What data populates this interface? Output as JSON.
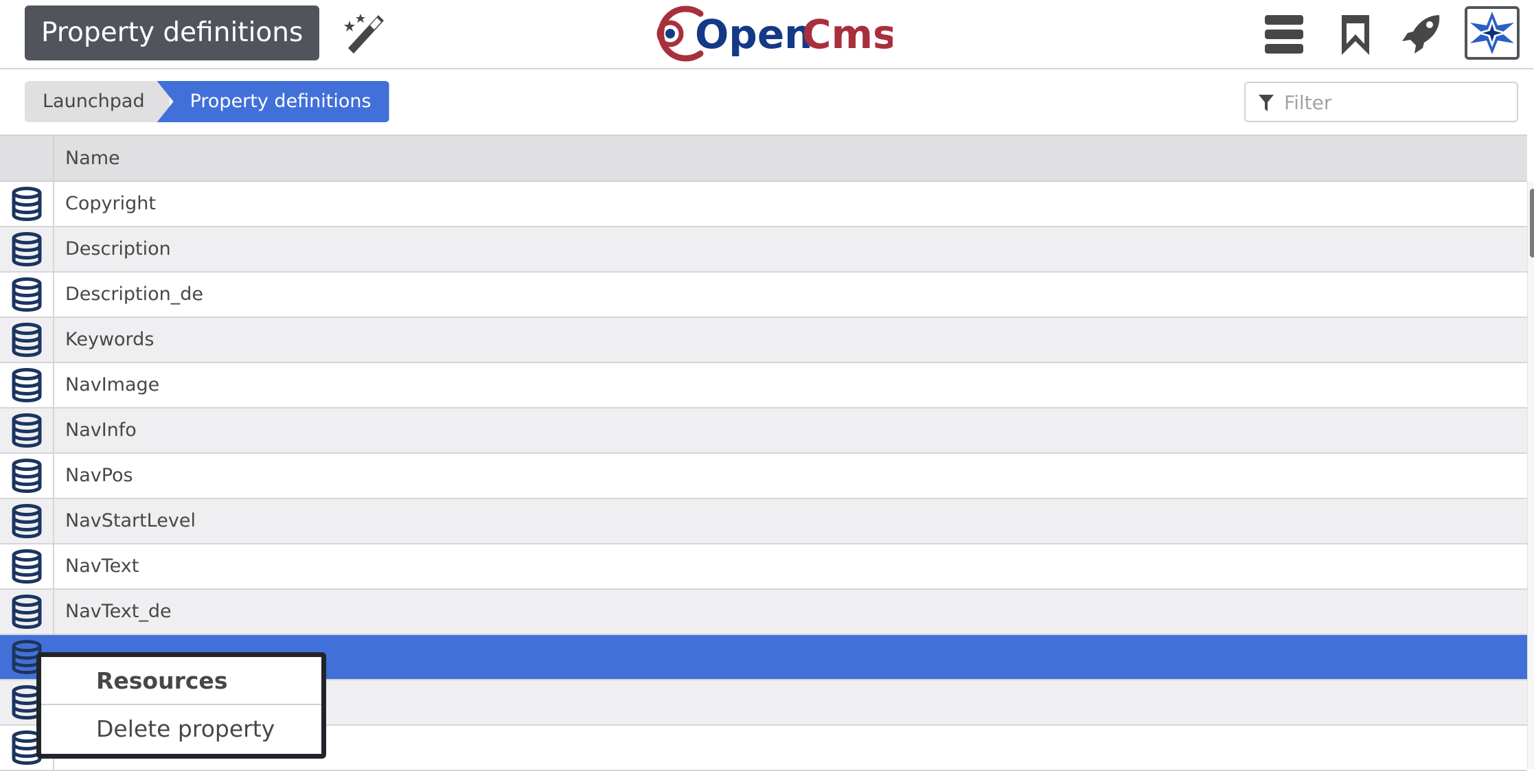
{
  "header": {
    "app_title": "Property definitions",
    "logo_text": "OpenCms",
    "icons": [
      "magic-wand-icon",
      "menu-icon",
      "bookmark-icon",
      "rocket-icon",
      "user-avatar"
    ]
  },
  "breadcrumb": {
    "items": [
      {
        "label": "Launchpad"
      },
      {
        "label": "Property definitions"
      }
    ]
  },
  "filter": {
    "placeholder": "Filter",
    "value": ""
  },
  "table": {
    "columns": [
      "Name"
    ],
    "rows": [
      {
        "name": "Copyright"
      },
      {
        "name": "Description"
      },
      {
        "name": "Description_de"
      },
      {
        "name": "Keywords"
      },
      {
        "name": "NavImage"
      },
      {
        "name": "NavInfo"
      },
      {
        "name": "NavPos"
      },
      {
        "name": "NavStartLevel"
      },
      {
        "name": "NavText"
      },
      {
        "name": "NavText_de"
      },
      {
        "name": "",
        "selected": true
      },
      {
        "name": ""
      },
      {
        "name": ""
      }
    ]
  },
  "context_menu": {
    "items": [
      {
        "label": "Resources"
      },
      {
        "label": "Delete property"
      }
    ]
  },
  "colors": {
    "accent": "#4170d9",
    "title_bg": "#51555b",
    "icon_navy": "#1b3560",
    "logo_red": "#a8303d",
    "logo_blue": "#143a86"
  }
}
